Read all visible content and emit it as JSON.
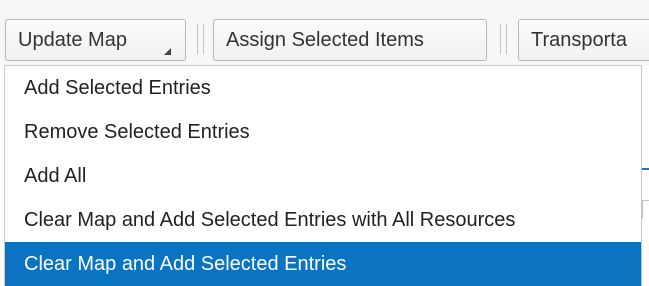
{
  "toolbar": {
    "update_map_label": "Update Map",
    "assign_label": "Assign Selected Items",
    "transport_label": "Transporta"
  },
  "menu": {
    "items": [
      {
        "label": "Add Selected Entries",
        "selected": false
      },
      {
        "label": "Remove Selected Entries",
        "selected": false
      },
      {
        "label": "Add All",
        "selected": false
      },
      {
        "label": "Clear Map and Add Selected Entries with All Resources",
        "selected": false
      },
      {
        "label": "Clear Map and Add Selected Entries",
        "selected": true
      }
    ]
  },
  "colors": {
    "selection": "#0a73c2",
    "toolbar_bg": "#f7f7f7"
  }
}
